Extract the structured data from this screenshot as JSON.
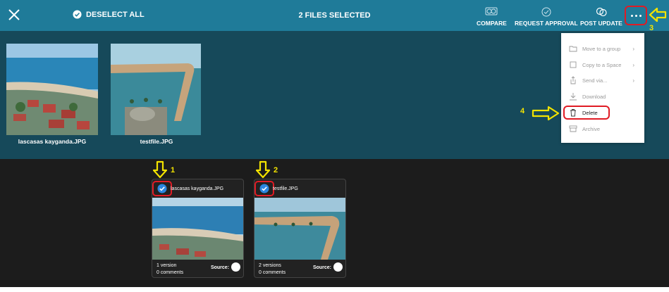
{
  "header": {
    "deselect_label": "DESELECT ALL",
    "title": "2 FILES SELECTED",
    "tools": [
      {
        "label": "COMPARE",
        "icon": "compare-icon"
      },
      {
        "label": "REQUEST APPROVAL",
        "icon": "check-circle-icon"
      },
      {
        "label": "POST UPDATE",
        "icon": "chat-bubbles-icon"
      }
    ],
    "more_icon": "ellipsis-icon"
  },
  "preview": {
    "files": [
      {
        "label": "lascasas kayganda.JPG"
      },
      {
        "label": "testfile.JPG"
      }
    ]
  },
  "menu": {
    "items": [
      {
        "label": "Move to a group",
        "icon": "folder-icon",
        "submenu": true
      },
      {
        "label": "Copy to a Space",
        "icon": "copy-icon",
        "submenu": true
      },
      {
        "label": "Send via...",
        "icon": "share-icon",
        "submenu": true
      },
      {
        "label": "Download",
        "icon": "download-icon",
        "submenu": false
      },
      {
        "label": "Delete",
        "icon": "trash-icon",
        "submenu": false
      },
      {
        "label": "Archive",
        "icon": "archive-icon",
        "submenu": false
      }
    ]
  },
  "cards": [
    {
      "name": "lascasas kayganda.JPG",
      "versions": "1 version",
      "comments": "0 comments",
      "source_label": "Source:"
    },
    {
      "name": "testfile.JPG",
      "versions": "2 versions",
      "comments": "0 comments",
      "source_label": "Source:"
    }
  ],
  "annotations": {
    "a1": "1",
    "a2": "2",
    "a3": "3",
    "a4": "4"
  },
  "colors": {
    "header": "#1f7b99",
    "preview_bg": "#16495a",
    "grid_bg": "#1c1c1c",
    "highlight": "#e01b24",
    "annotation": "#f3e300",
    "check": "#2b86e0"
  }
}
